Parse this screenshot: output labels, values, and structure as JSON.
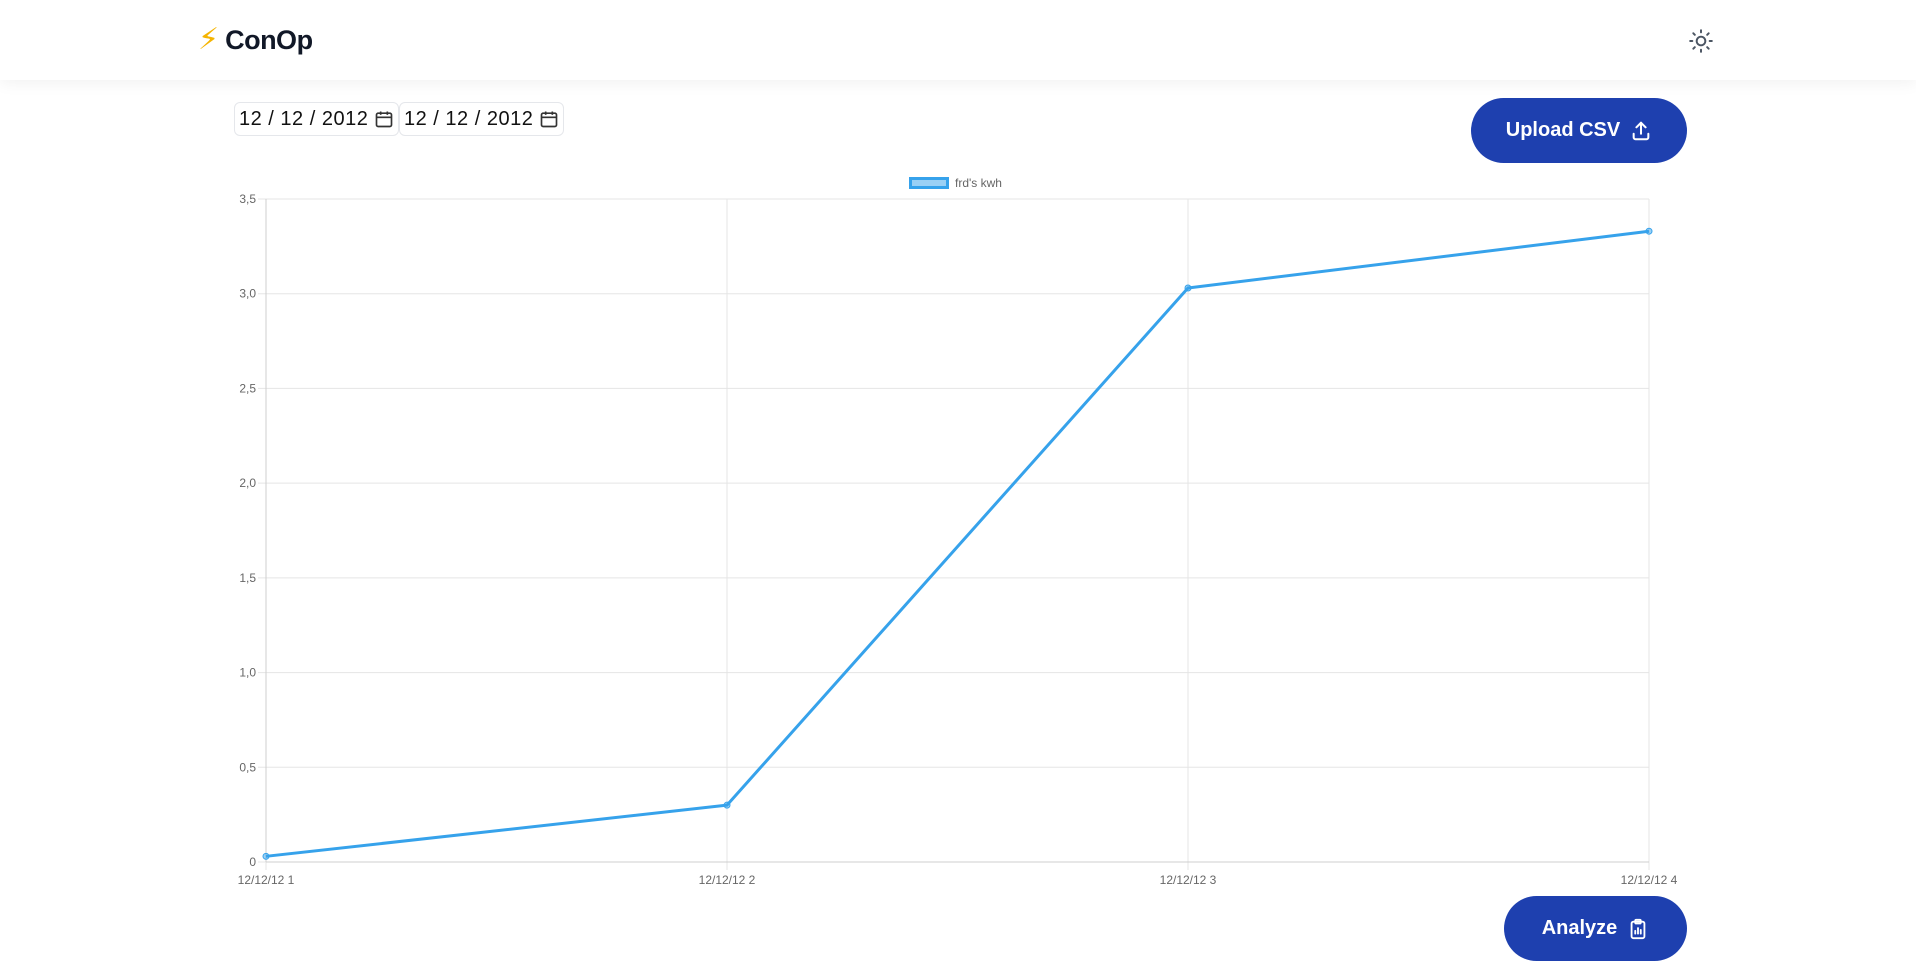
{
  "app": {
    "logo_icon": "⚡",
    "name": "ConOp"
  },
  "header": {
    "theme_icon": "sun-icon"
  },
  "filters": {
    "start_date": "12 / 12 / 2012",
    "end_date": "12 / 12 / 2012",
    "calendar_icon": "calendar-icon"
  },
  "buttons": {
    "upload_label": "Upload CSV",
    "upload_icon": "upload-icon",
    "analyze_label": "Analyze",
    "analyze_icon": "clipboard-chart-icon"
  },
  "colors": {
    "primary": "#1e40af",
    "series": "#36a2eb",
    "grid": "#e5e5e5"
  },
  "chart_data": {
    "type": "line",
    "categories": [
      "12/12/12 1",
      "12/12/12 2",
      "12/12/12 3",
      "12/12/12 4"
    ],
    "series": [
      {
        "name": "frd's kwh",
        "values": [
          0.03,
          0.3,
          3.03,
          3.33
        ]
      }
    ],
    "ylim": [
      0,
      3.5
    ],
    "yticks": [
      "0",
      "0,5",
      "1,0",
      "1,5",
      "2,0",
      "2,5",
      "3,0",
      "3,5"
    ],
    "grid": true,
    "legend_position": "top-center"
  }
}
